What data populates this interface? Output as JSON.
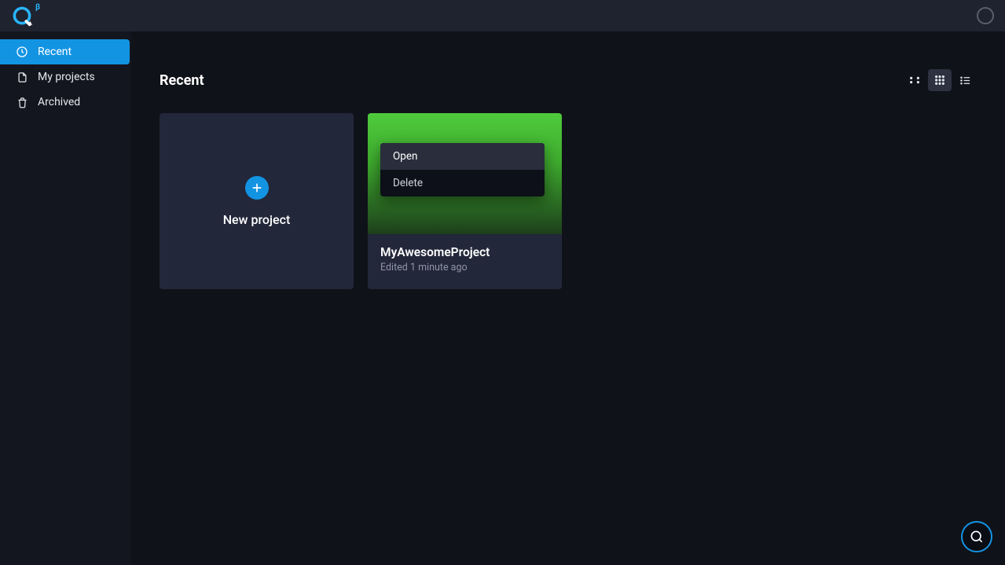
{
  "app": {
    "beta_tag": "β"
  },
  "sidebar": {
    "items": [
      {
        "label": "Recent",
        "icon": "clock-icon",
        "active": true
      },
      {
        "label": "My projects",
        "icon": "file-icon",
        "active": false
      },
      {
        "label": "Archived",
        "icon": "trash-icon",
        "active": false
      }
    ]
  },
  "main": {
    "title": "Recent",
    "new_project_label": "New project",
    "projects": [
      {
        "name": "MyAwesomeProject",
        "edited": "Edited 1 minute ago"
      }
    ],
    "context_menu": {
      "open": "Open",
      "delete": "Delete"
    },
    "view": {
      "active": "grid"
    }
  }
}
